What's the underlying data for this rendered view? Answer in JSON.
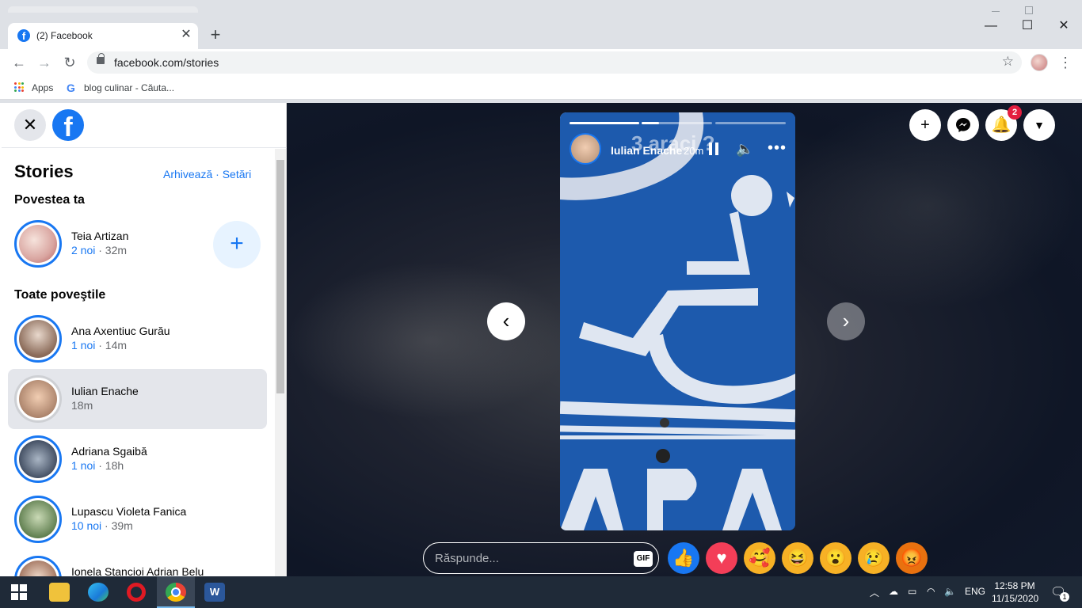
{
  "browser": {
    "tab_title": "(2) Facebook",
    "url": "facebook.com/stories",
    "bookmarks": [
      {
        "label": "Apps"
      },
      {
        "label": "blog culinar - Căuta..."
      }
    ]
  },
  "sidebar": {
    "title": "Stories",
    "archive_link": "Arhivează",
    "separator": "·",
    "settings_link": "Setări",
    "your_story_heading": "Povestea ta",
    "your_story": {
      "name": "Teia Artizan",
      "new": "2 noi",
      "time": "· 32m"
    },
    "all_stories_heading": "Toate poveştile",
    "stories": [
      {
        "name": "Ana Axentiuc Gurău",
        "new": "1 noi",
        "time": "· 14m"
      },
      {
        "name": "Iulian Enache",
        "new": "",
        "time": "18m"
      },
      {
        "name": "Adriana Sgaibă",
        "new": "1 noi",
        "time": "· 18h"
      },
      {
        "name": "Lupascu Violeta Fanica",
        "new": "10 noi",
        "time": "· 39m"
      },
      {
        "name": "Ionela Stancioi Adrian Belu",
        "new": "",
        "time": ""
      }
    ]
  },
  "viewer": {
    "author": "Iulian Enache",
    "time": "20m",
    "overlay_text": "3 araci ?",
    "progress": [
      1.0,
      0.25,
      0.0
    ],
    "notifications_badge": "2",
    "reply_placeholder": "Răspunde...",
    "gif_label": "GIF",
    "reactions": [
      "like",
      "love",
      "care",
      "haha",
      "wow",
      "sad",
      "angry"
    ]
  },
  "taskbar": {
    "language": "ENG",
    "time": "12:58 PM",
    "date": "11/15/2020",
    "notification_count": "1"
  },
  "colors": {
    "facebook_blue": "#1877f2",
    "viewer_bg": "#121a2b",
    "badge_red": "#e41e3f"
  }
}
